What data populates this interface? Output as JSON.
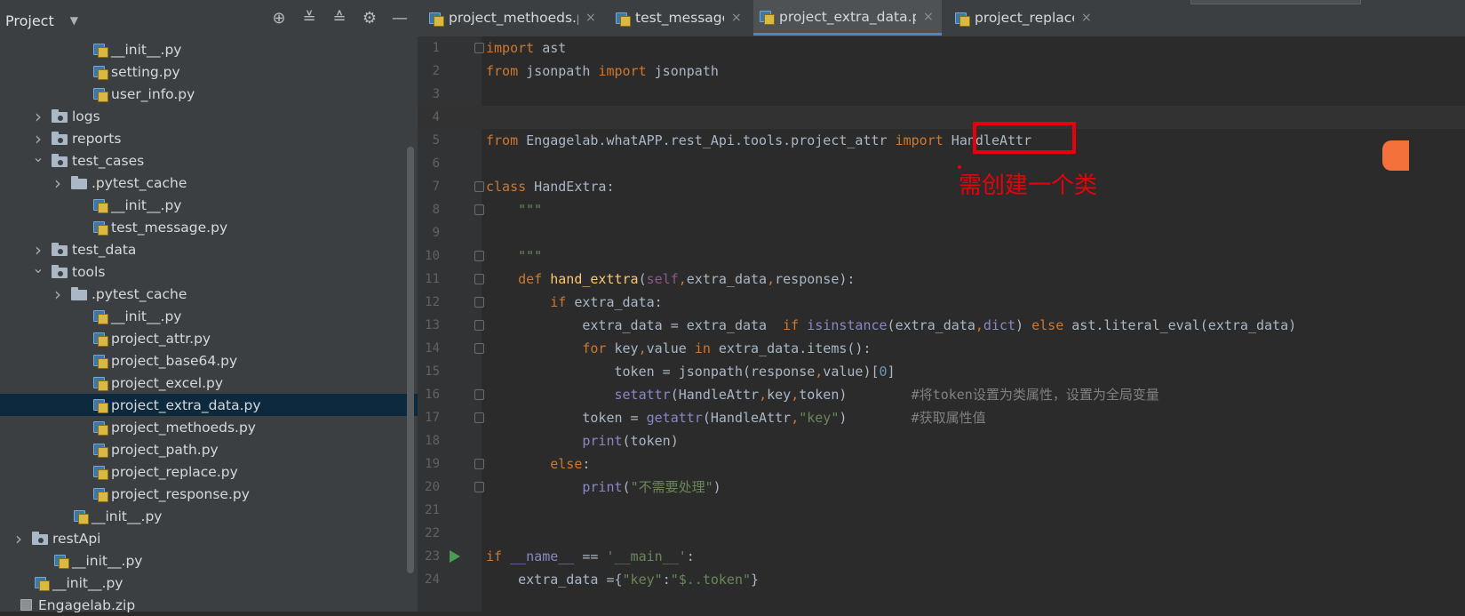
{
  "project_panel": {
    "title": "Project",
    "header_icons": [
      "target-icon",
      "expand-all-icon",
      "collapse-all-icon",
      "gear-icon",
      "minimize-icon"
    ],
    "tree": [
      {
        "label": "__init__.py",
        "type": "py",
        "indent": 104,
        "arrow": "none"
      },
      {
        "label": "setting.py",
        "type": "py",
        "indent": 104,
        "arrow": "none"
      },
      {
        "label": "user_info.py",
        "type": "py",
        "indent": 104,
        "arrow": "none"
      },
      {
        "label": "logs",
        "type": "folder",
        "indent": 58,
        "arrow": "right"
      },
      {
        "label": "reports",
        "type": "folder",
        "indent": 58,
        "arrow": "right"
      },
      {
        "label": "test_cases",
        "type": "folder",
        "indent": 58,
        "arrow": "down"
      },
      {
        "label": ".pytest_cache",
        "type": "folder-plain",
        "indent": 80,
        "arrow": "right"
      },
      {
        "label": "__init__.py",
        "type": "py",
        "indent": 104,
        "arrow": "none"
      },
      {
        "label": "test_message.py",
        "type": "py",
        "indent": 104,
        "arrow": "none"
      },
      {
        "label": "test_data",
        "type": "folder",
        "indent": 58,
        "arrow": "right"
      },
      {
        "label": "tools",
        "type": "folder",
        "indent": 58,
        "arrow": "down"
      },
      {
        "label": ".pytest_cache",
        "type": "folder-plain",
        "indent": 80,
        "arrow": "right"
      },
      {
        "label": "__init__.py",
        "type": "py",
        "indent": 104,
        "arrow": "none"
      },
      {
        "label": "project_attr.py",
        "type": "py",
        "indent": 104,
        "arrow": "none"
      },
      {
        "label": "project_base64.py",
        "type": "py",
        "indent": 104,
        "arrow": "none"
      },
      {
        "label": "project_excel.py",
        "type": "py",
        "indent": 104,
        "arrow": "none"
      },
      {
        "label": "project_extra_data.py",
        "type": "py",
        "indent": 104,
        "arrow": "none",
        "selected": true
      },
      {
        "label": "project_methoeds.py",
        "type": "py",
        "indent": 104,
        "arrow": "none"
      },
      {
        "label": "project_path.py",
        "type": "py",
        "indent": 104,
        "arrow": "none"
      },
      {
        "label": "project_replace.py",
        "type": "py",
        "indent": 104,
        "arrow": "none"
      },
      {
        "label": "project_response.py",
        "type": "py",
        "indent": 104,
        "arrow": "none"
      },
      {
        "label": "__init__.py",
        "type": "py",
        "indent": 82,
        "arrow": "none"
      },
      {
        "label": "restApi",
        "type": "folder",
        "indent": 36,
        "arrow": "right"
      },
      {
        "label": "__init__.py",
        "type": "py",
        "indent": 60,
        "arrow": "none"
      },
      {
        "label": "__init__.py",
        "type": "py",
        "indent": 38,
        "arrow": "none"
      },
      {
        "label": "Engagelab.zip",
        "type": "zip",
        "indent": 16,
        "arrow": "none"
      }
    ]
  },
  "tabs": [
    {
      "label": "project_methoeds.py",
      "active": false
    },
    {
      "label": "test_message.py",
      "active": false
    },
    {
      "label": "project_extra_data.py",
      "active": true
    },
    {
      "label": "project_replace.py",
      "active": false
    }
  ],
  "tab_close_glyph": "×",
  "editor": {
    "line_numbers": [
      "1",
      "2",
      "3",
      "4",
      "5",
      "6",
      "7",
      "8",
      "9",
      "10",
      "11",
      "12",
      "13",
      "14",
      "15",
      "16",
      "17",
      "18",
      "19",
      "20",
      "21",
      "22",
      "23",
      "24"
    ],
    "lines": [
      "import ast",
      "from jsonpath import jsonpath",
      "",
      "",
      "from Engagelab.whatAPP.rest_Api.tools.project_attr import HandleAttr",
      "",
      "class HandExtra:",
      "    \"\"\"",
      "",
      "    \"\"\"",
      "    def hand_exttra(self,extra_data,response):",
      "        if extra_data:",
      "            extra_data = extra_data  if isinstance(extra_data,dict) else ast.literal_eval(extra_data)",
      "            for key,value in extra_data.items():",
      "                token = jsonpath(response,value)[0]",
      "                setattr(HandleAttr,key,token)        #将token设置为类属性，设置为全局变量",
      "            token = getattr(HandleAttr,\"key\")        #获取属性值",
      "            print(token)",
      "        else:",
      "            print(\"不需要处理\")",
      "",
      "",
      "if __name__ == '__main__':",
      "    extra_data ={\"key\":\"$..token\"}"
    ]
  },
  "annotation": {
    "text": "需创建一个类",
    "color": "#e8000b"
  },
  "colors": {
    "keyword": "#cc7832",
    "function": "#ffc66d",
    "string": "#6a8759",
    "self": "#94558d",
    "number": "#6897bb",
    "builtin": "#8888c6",
    "comment": "#808080",
    "default": "#a9b7c6",
    "selection": "#0d293e",
    "tab_underline": "#4a88c7"
  }
}
